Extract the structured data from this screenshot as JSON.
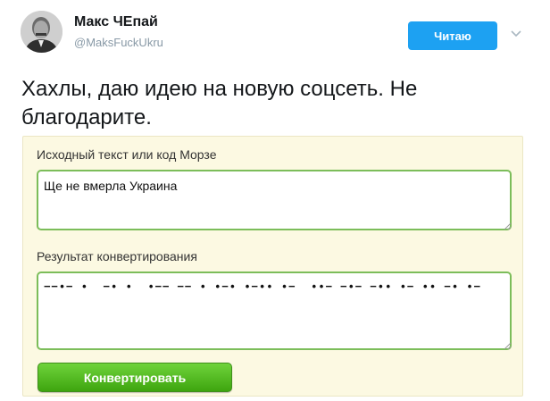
{
  "tweet": {
    "author_name": "Макс ЧЕпай",
    "author_handle": "@MaksFuckUkru",
    "follow_label": "Читаю",
    "text": "Хахлы, даю идею на новую соцсеть. Не благодарите.",
    "avatar_icon": "person-photo-icon",
    "menu_icon": "chevron-down-icon"
  },
  "converter": {
    "source_label": "Исходный текст или код Морзе",
    "source_value": "Ще не вмерла Украина",
    "result_label": "Результат конвертирования",
    "result_value": "−−•− •  −• •  •−− −− • •−• •−•• •−  ••− −•− −•• •− •• −• •−",
    "convert_label": "Конвертировать"
  },
  "colors": {
    "follow_button": "#1da1f2",
    "panel_background": "#fcf9e2",
    "field_border": "#7cbd5a",
    "convert_button": "#4cb31a"
  }
}
